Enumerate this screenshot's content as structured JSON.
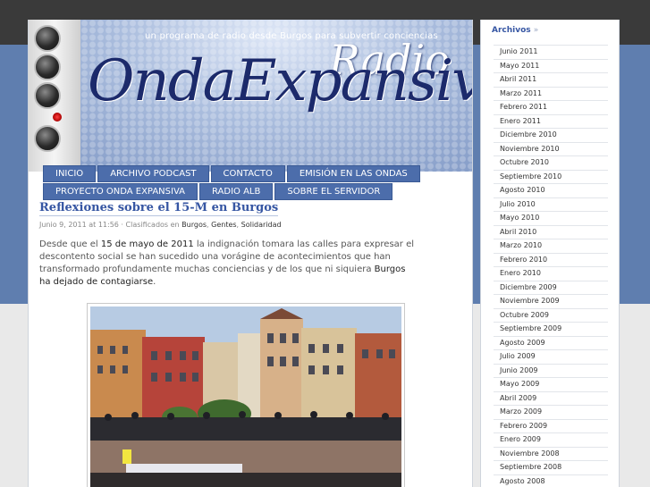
{
  "header": {
    "tagline": "un programa de radio desde Burgos para subvertir conciencias",
    "logo_main": "OndaExpansiva",
    "logo_radio": "Radio"
  },
  "nav": {
    "row1": [
      "INICIO",
      "ARCHIVO PODCAST",
      "CONTACTO",
      "EMISIÓN EN LAS ONDAS"
    ],
    "row2": [
      "PROYECTO ONDA EXPANSIVA",
      "RADIO ALB",
      "SOBRE EL SERVIDOR"
    ]
  },
  "post": {
    "title": "Reflexiones sobre el 15-M en Burgos",
    "meta_date": "Junio 9, 2011 at 11:56 · Clasificados en",
    "categories": [
      "Burgos",
      "Gentes",
      "Solidaridad"
    ],
    "body_1": "Desde que el",
    "body_link_1": "15 de mayo de 2011",
    "body_2": "la indignación tomara las calles para expresar el descontento social se han sucedido una vorágine de acontecimientos que han transformado profundamente muchas conciencias  y de los que ni siquiera",
    "body_link_2": "Burgos ha dejado de contagiarse",
    "body_3": "."
  },
  "sidebar": {
    "heading": "Archivos",
    "heading_arrow": "»",
    "archives": [
      "Junio 2011",
      "Mayo 2011",
      "Abril 2011",
      "Marzo 2011",
      "Febrero 2011",
      "Enero 2011",
      "Diciembre 2010",
      "Noviembre 2010",
      "Octubre 2010",
      "Septiembre 2010",
      "Agosto 2010",
      "Julio 2010",
      "Mayo 2010",
      "Abril 2010",
      "Marzo 2010",
      "Febrero 2010",
      "Enero 2010",
      "Diciembre 2009",
      "Noviembre 2009",
      "Octubre 2009",
      "Septiembre 2009",
      "Agosto 2009",
      "Julio 2009",
      "Junio 2009",
      "Mayo 2009",
      "Abril 2009",
      "Marzo 2009",
      "Febrero 2009",
      "Enero 2009",
      "Noviembre 2008",
      "Septiembre 2008",
      "Agosto 2008"
    ]
  },
  "colors": {
    "nav_bg": "#4c6dab",
    "title_blue": "#3656a3",
    "page_blue": "#5f7eaf"
  }
}
